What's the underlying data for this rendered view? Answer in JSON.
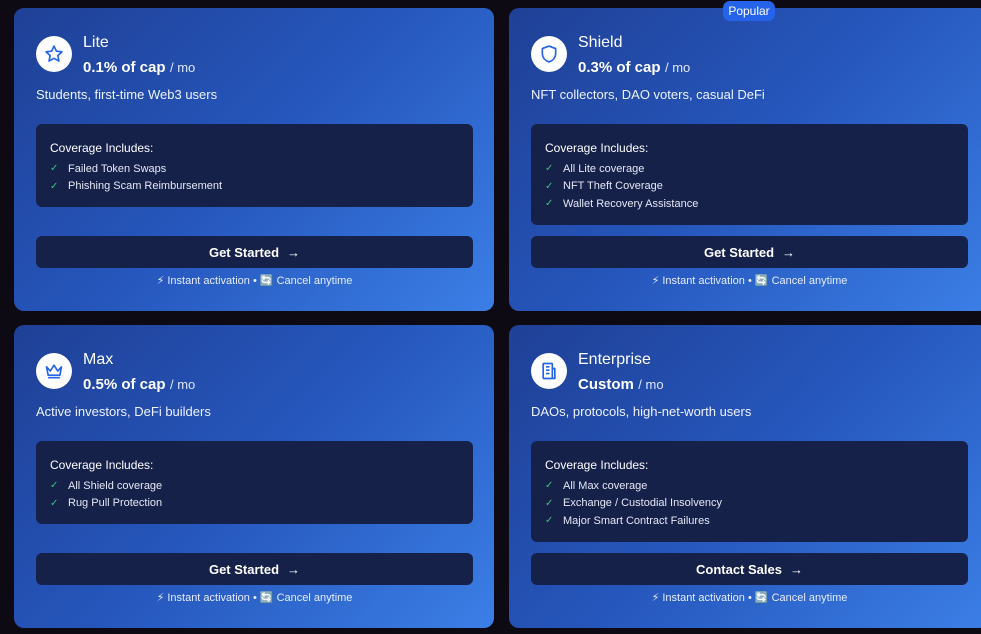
{
  "plans": [
    {
      "name": "Lite",
      "icon": "star-icon",
      "price": "0.1% of cap",
      "period": "/ mo",
      "audience": "Students, first-time Web3 users",
      "coverage_title": "Coverage Includes:",
      "coverage": [
        "Failed Token Swaps",
        "Phishing Scam Reimbursement"
      ],
      "cta": "Get Started",
      "footnote": "⚡ Instant activation • 🔄 Cancel anytime"
    },
    {
      "name": "Shield",
      "icon": "shield-icon",
      "badge": "Popular",
      "price": "0.3% of cap",
      "period": "/ mo",
      "audience": "NFT collectors, DAO voters, casual DeFi",
      "coverage_title": "Coverage Includes:",
      "coverage": [
        "All Lite coverage",
        "NFT Theft Coverage",
        "Wallet Recovery Assistance"
      ],
      "cta": "Get Started",
      "footnote": "⚡ Instant activation • 🔄 Cancel anytime"
    },
    {
      "name": "Max",
      "icon": "crown-icon",
      "price": "0.5% of cap",
      "period": "/ mo",
      "audience": "Active investors, DeFi builders",
      "coverage_title": "Coverage Includes:",
      "coverage": [
        "All Shield coverage",
        "Rug Pull Protection"
      ],
      "cta": "Get Started",
      "footnote": "⚡ Instant activation • 🔄 Cancel anytime"
    },
    {
      "name": "Enterprise",
      "icon": "building-icon",
      "price": "Custom",
      "period": "/ mo",
      "audience": "DAOs, protocols, high-net-worth users",
      "coverage_title": "Coverage Includes:",
      "coverage": [
        "All Max coverage",
        "Exchange / Custodial Insolvency",
        "Major Smart Contract Failures"
      ],
      "cta": "Contact Sales",
      "footnote": "⚡ Instant activation • 🔄 Cancel anytime"
    }
  ],
  "colors": {
    "page_bg": "#0d0a14",
    "card_gradient_start": "#1f4096",
    "card_gradient_end": "#3b7fe6",
    "panel_bg": "#16214a",
    "badge_bg": "#2563eb",
    "check": "#3fbf7f",
    "icon_stroke": "#2563eb"
  }
}
